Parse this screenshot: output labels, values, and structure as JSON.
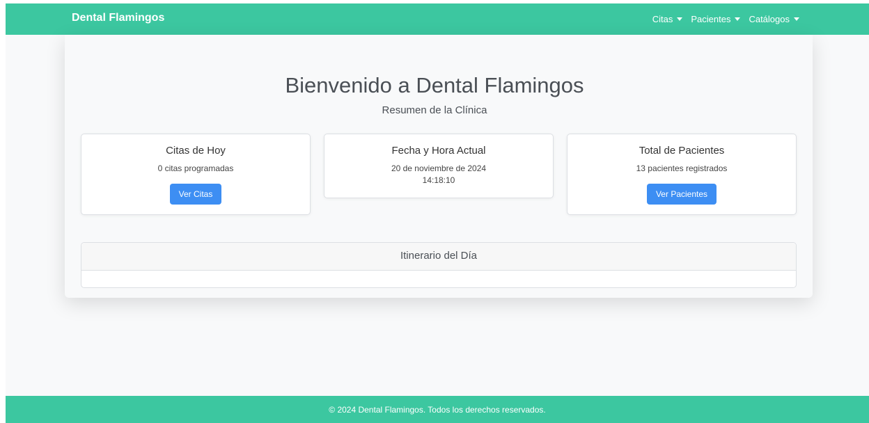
{
  "navbar": {
    "brand": "Dental Flamingos",
    "items": [
      {
        "label": "Citas"
      },
      {
        "label": "Pacientes"
      },
      {
        "label": "Catálogos"
      }
    ]
  },
  "main": {
    "title": "Bienvenido a Dental Flamingos",
    "subtitle": "Resumen de la Clínica",
    "cards": [
      {
        "title": "Citas de Hoy",
        "text": "0 citas programadas",
        "button": "Ver Citas"
      },
      {
        "title": "Fecha y Hora Actual",
        "date": "20 de noviembre de 2024",
        "time": "14:18:10"
      },
      {
        "title": "Total de Pacientes",
        "text": "13 pacientes registrados",
        "button": "Ver Pacientes"
      }
    ],
    "itinerary": {
      "title": "Itinerario del Día"
    }
  },
  "footer": {
    "text": "© 2024 Dental Flamingos. Todos los derechos reservados."
  },
  "colors": {
    "brand": "#3cc7a0",
    "button": "#3d8ef3",
    "background": "#f8f9fa"
  }
}
